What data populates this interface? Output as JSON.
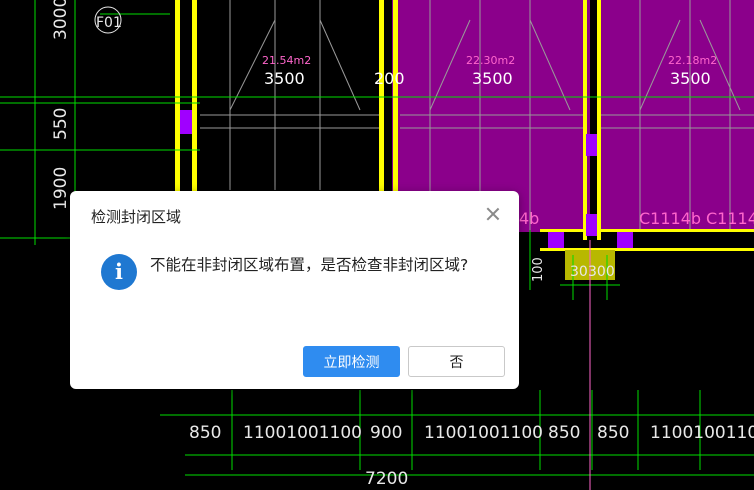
{
  "drawing": {
    "left_dims": [
      "3000",
      "550",
      "1900"
    ],
    "axis_tag": "F01",
    "rooms": [
      {
        "area": "21.54m2",
        "width": "3500"
      },
      {
        "area": "22.30m2",
        "width": "3500"
      },
      {
        "area": "22.18m2",
        "width": "3500"
      }
    ],
    "mid_top_dim": "200",
    "door_tags": [
      "4b",
      "C1114b",
      "C1114"
    ],
    "small_dims": [
      "100",
      "30",
      "300"
    ],
    "bottom_dims": [
      "850",
      "11001001100",
      "900",
      "11001001100",
      "850",
      "850",
      "11001001100"
    ],
    "total_dim": "7200"
  },
  "colors": {
    "background": "#000000",
    "room_fill": "#8b008b",
    "wall": "#ffff00",
    "column": "#a000ff",
    "dim_line": "#00dd00",
    "accent": "#2f8cf0"
  },
  "dialog": {
    "title": "检测封闭区域",
    "icon": "info-icon",
    "message": "不能在非封闭区域布置，是否检查非封闭区域?",
    "primary_button": "立即检测",
    "secondary_button": "否"
  }
}
